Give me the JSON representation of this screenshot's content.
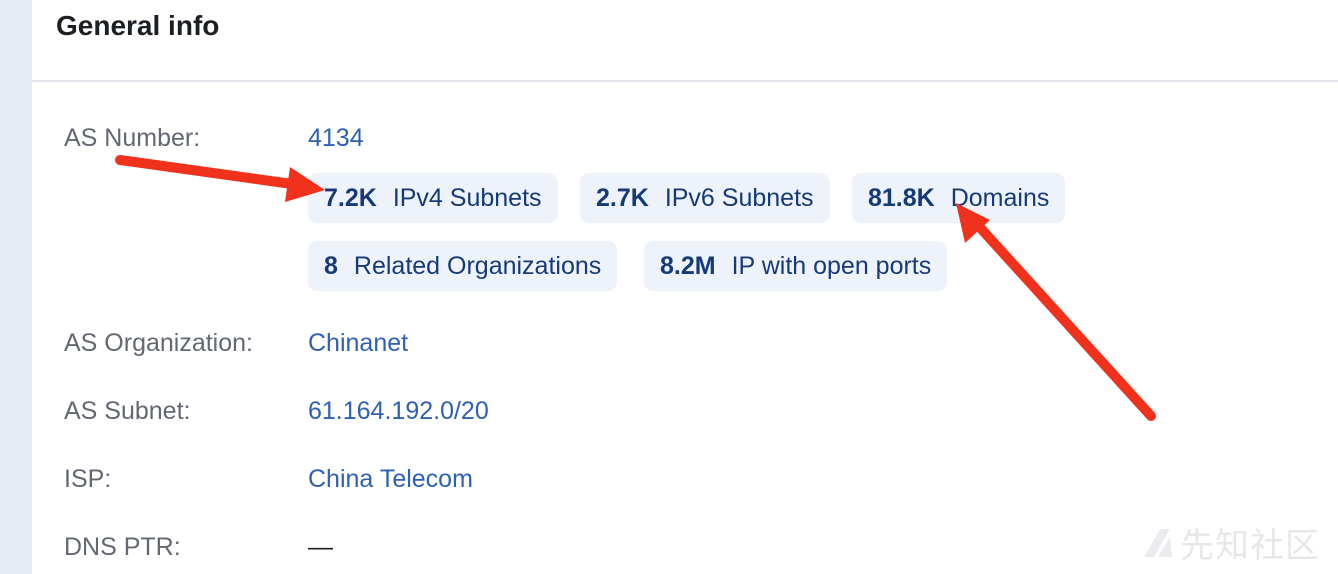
{
  "panel": {
    "title": "General info"
  },
  "rows": {
    "as_number": {
      "label": "AS Number:",
      "value": "4134"
    },
    "as_organization": {
      "label": "AS Organization:",
      "value": "Chinanet"
    },
    "as_subnet": {
      "label": "AS Subnet:",
      "value": "61.164.192.0/20"
    },
    "isp": {
      "label": "ISP:",
      "value": "China Telecom"
    },
    "dns_ptr": {
      "label": "DNS PTR:",
      "value": "—"
    }
  },
  "chips": [
    {
      "count": "7.2K",
      "label": "IPv4 Subnets"
    },
    {
      "count": "2.7K",
      "label": "IPv6 Subnets"
    },
    {
      "count": "81.8K",
      "label": "Domains"
    },
    {
      "count": "8",
      "label": "Related Organizations"
    },
    {
      "count": "8.2M",
      "label": "IP with open ports"
    }
  ],
  "watermark": {
    "text": "先知社区"
  },
  "colors": {
    "link": "#2e61b5",
    "chip_bg": "#edf2fb",
    "chip_text": "#163a78",
    "arrow": "#f0321c",
    "left_rail": "#e7ebf3"
  },
  "annotations": {
    "arrow_count": 2
  }
}
